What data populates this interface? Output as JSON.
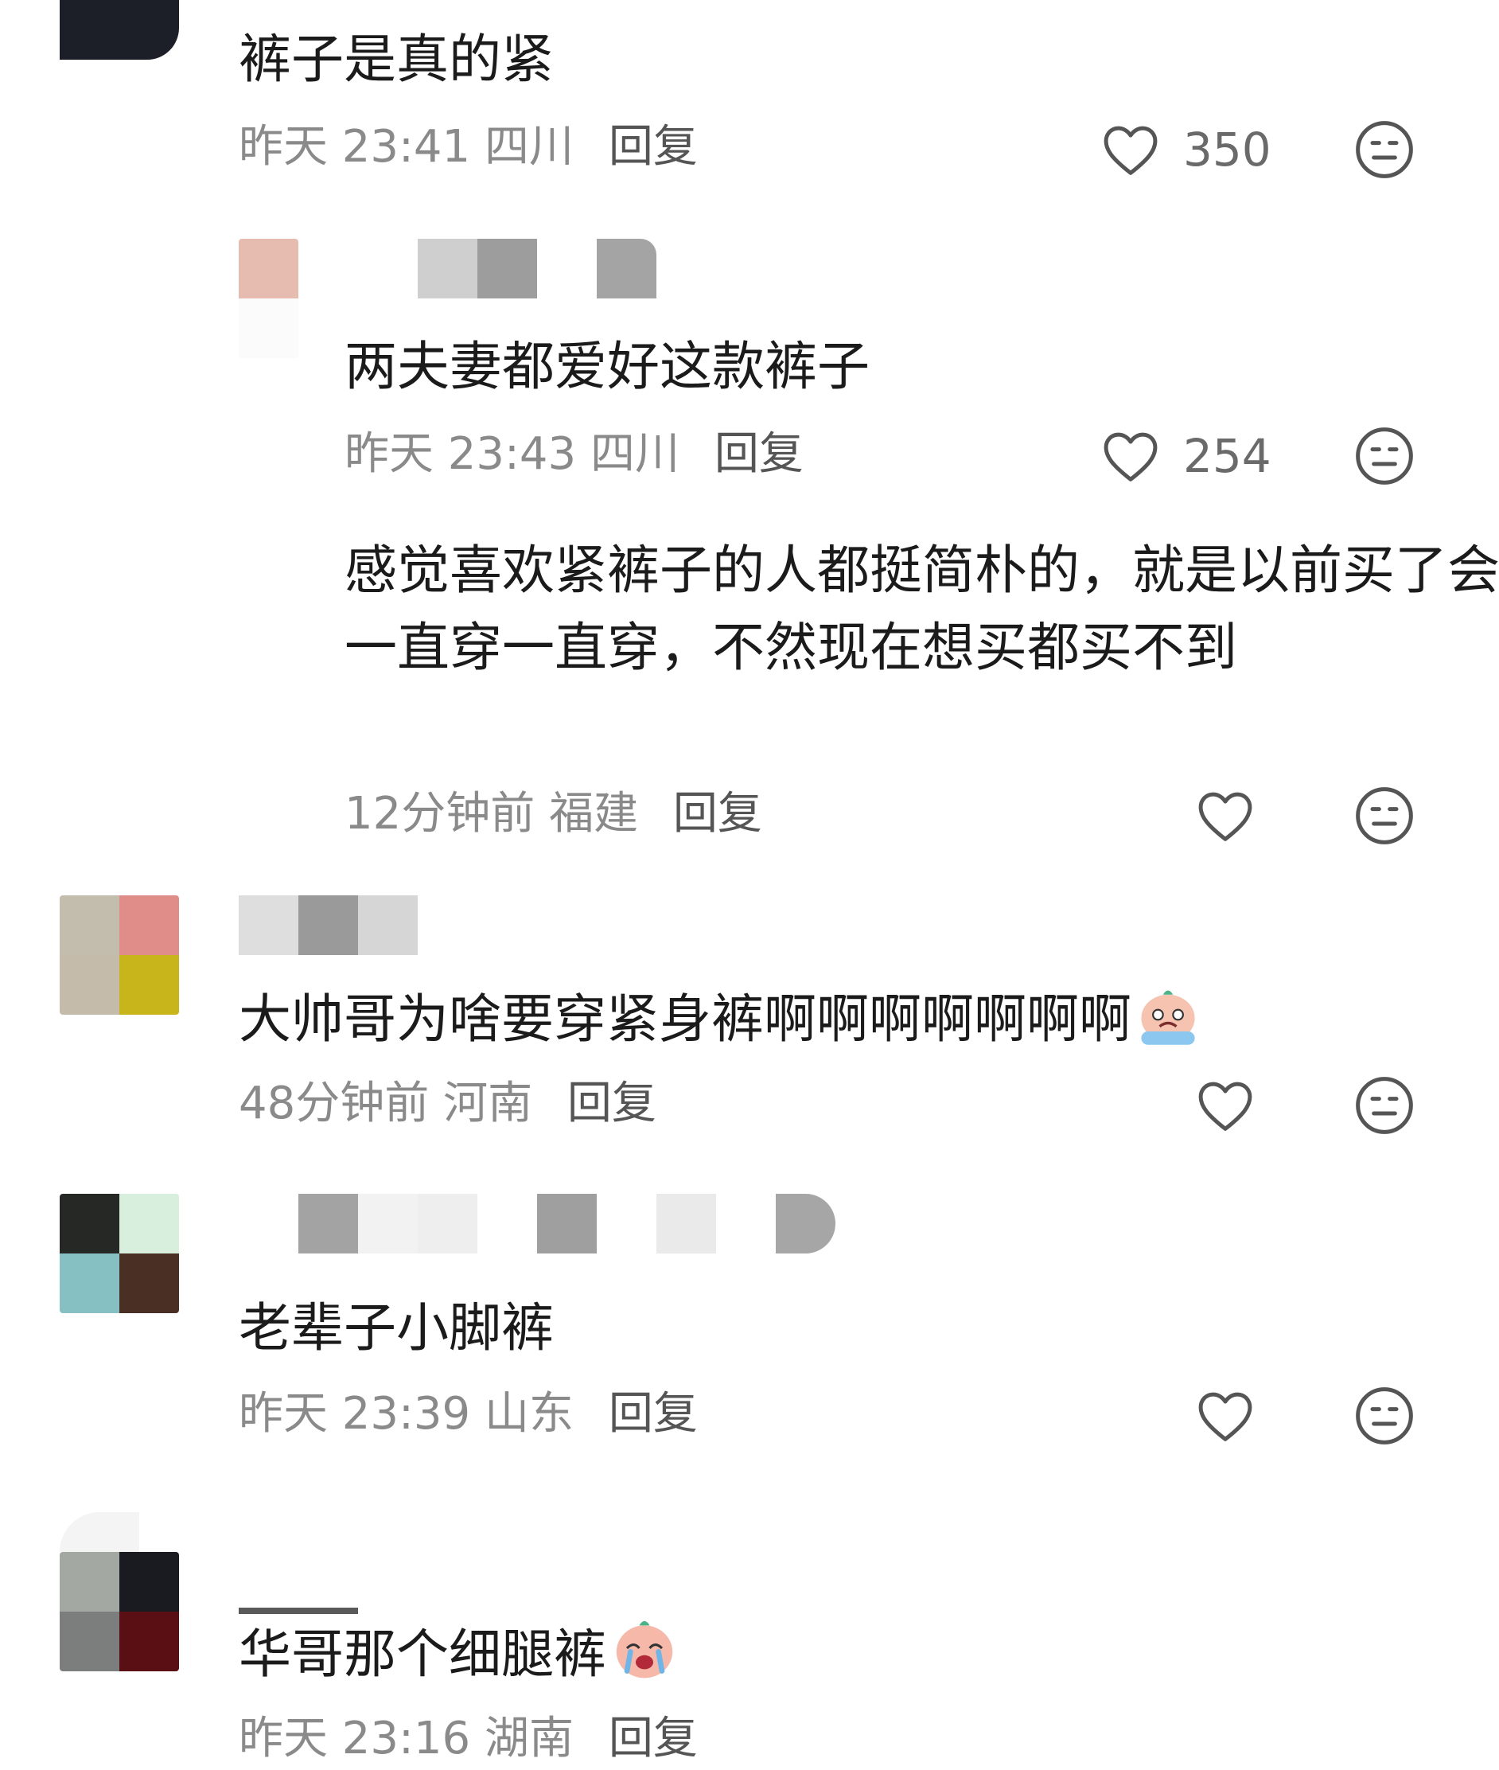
{
  "comments": [
    {
      "text": "裤子是真的紧",
      "time": "昨天 23:41",
      "location": "四川",
      "reply_label": "回复",
      "likes": "350"
    },
    {
      "text": "两夫妻都爱好这款裤子",
      "time": "昨天 23:43",
      "location": "四川",
      "reply_label": "回复",
      "likes": "254"
    },
    {
      "text": "感觉喜欢紧裤子的人都挺简朴的，就是以前买了会一直穿一直穿，不然现在想买都买不到",
      "time": "12分钟前",
      "location": "福建",
      "reply_label": "回复",
      "likes": ""
    },
    {
      "text": "大帅哥为啥要穿紧身裤啊啊啊啊啊啊啊",
      "time": "48分钟前",
      "location": "河南",
      "reply_label": "回复",
      "likes": "",
      "emoji": "crying-face-emoji"
    },
    {
      "text": "老辈子小脚裤",
      "time": "昨天 23:39",
      "location": "山东",
      "reply_label": "回复",
      "likes": ""
    },
    {
      "text": "华哥那个细腿裤",
      "time": "昨天 23:16",
      "location": "湖南",
      "reply_label": "回复",
      "likes": "",
      "emoji": "crying-face-emoji"
    }
  ],
  "icons": {
    "like": "heart-outline-icon",
    "react": "neutral-face-icon"
  },
  "colors": {
    "text": "#1b1b1b",
    "meta": "#8a8a8a",
    "reply": "#555555",
    "icon": "#555555"
  }
}
